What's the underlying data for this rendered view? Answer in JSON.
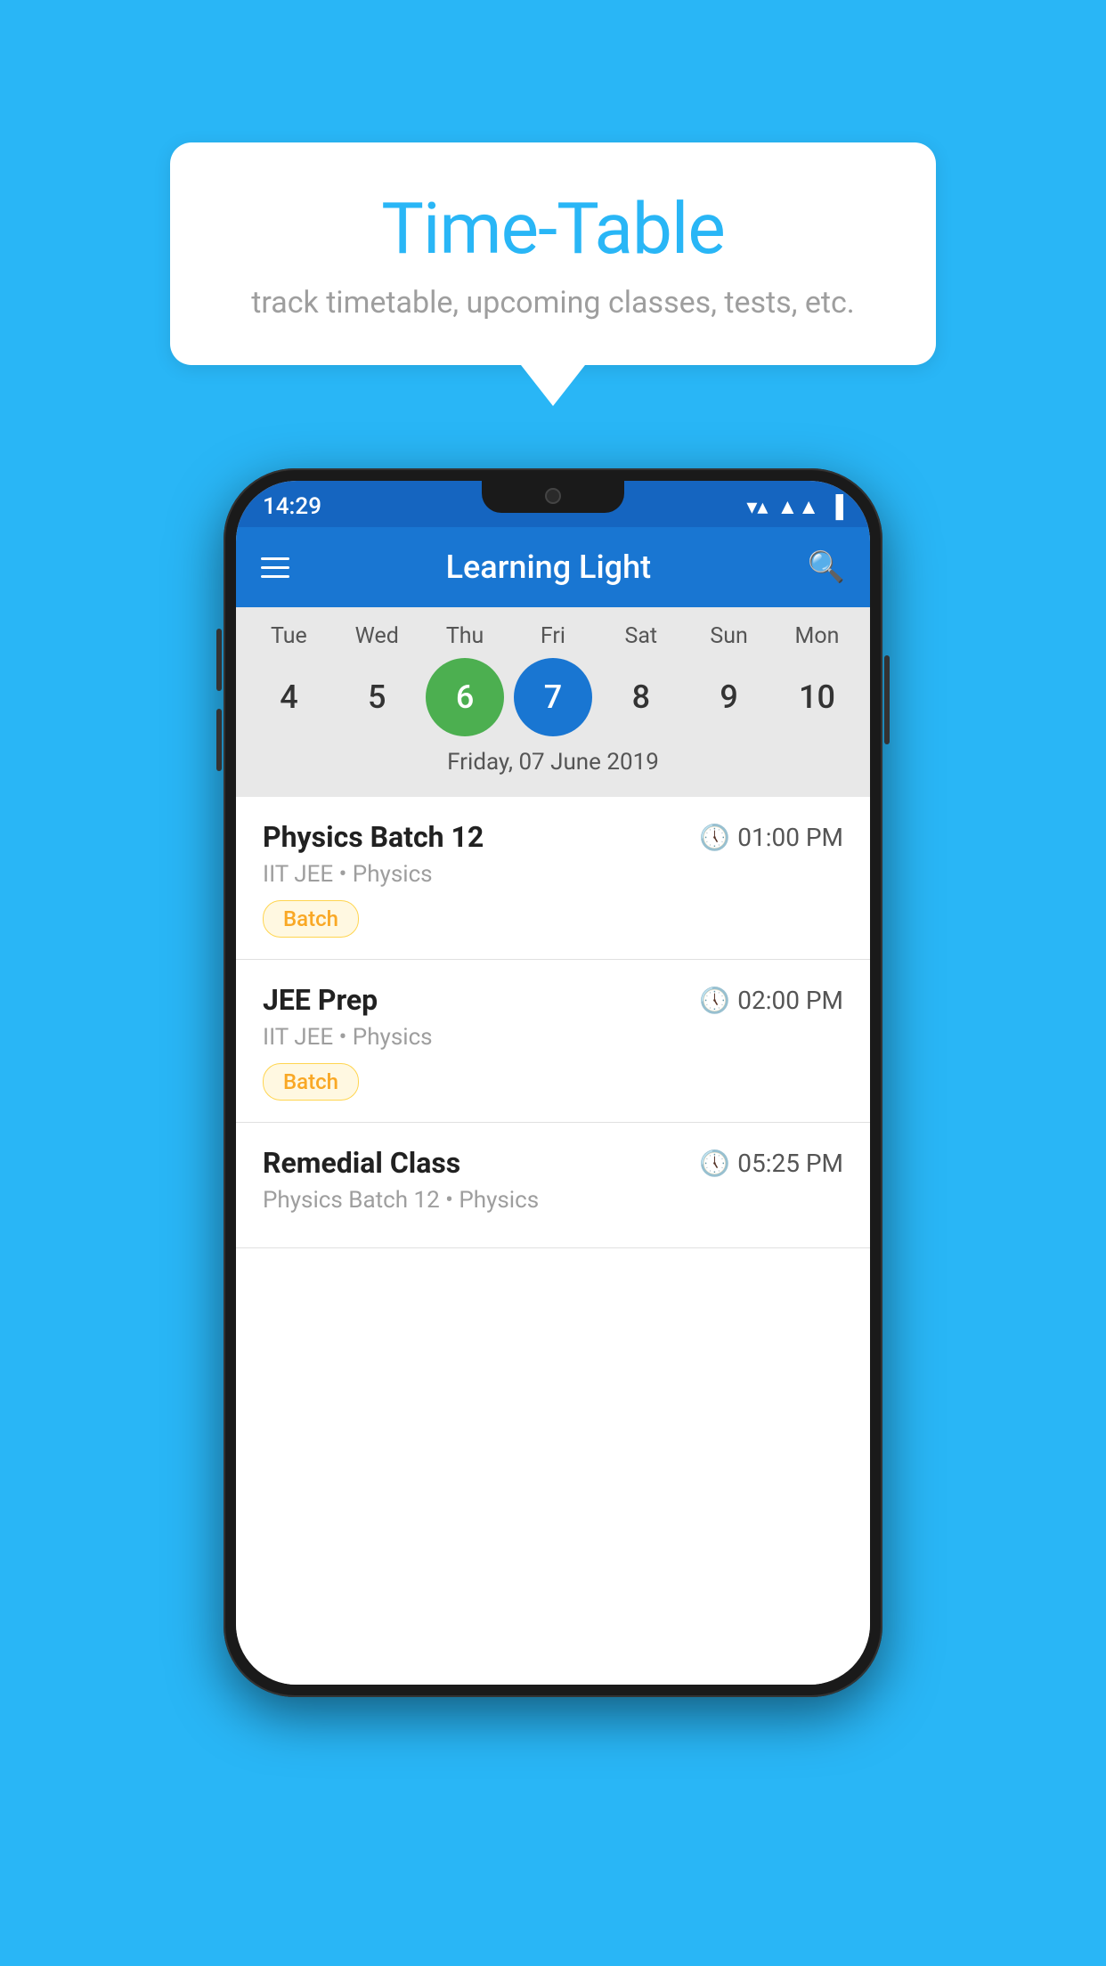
{
  "page": {
    "background_color": "#29B6F6"
  },
  "speech_bubble": {
    "title": "Time-Table",
    "subtitle": "track timetable, upcoming classes, tests, etc."
  },
  "status_bar": {
    "time": "14:29"
  },
  "app_bar": {
    "title": "Learning Light"
  },
  "calendar": {
    "selected_date_label": "Friday, 07 June 2019",
    "days": [
      {
        "name": "Tue",
        "number": "4",
        "state": "normal"
      },
      {
        "name": "Wed",
        "number": "5",
        "state": "normal"
      },
      {
        "name": "Thu",
        "number": "6",
        "state": "today"
      },
      {
        "name": "Fri",
        "number": "7",
        "state": "selected"
      },
      {
        "name": "Sat",
        "number": "8",
        "state": "normal"
      },
      {
        "name": "Sun",
        "number": "9",
        "state": "normal"
      },
      {
        "name": "Mon",
        "number": "10",
        "state": "normal"
      }
    ]
  },
  "schedule": [
    {
      "title": "Physics Batch 12",
      "time": "01:00 PM",
      "subtitle": "IIT JEE • Physics",
      "badge": "Batch"
    },
    {
      "title": "JEE Prep",
      "time": "02:00 PM",
      "subtitle": "IIT JEE • Physics",
      "badge": "Batch"
    },
    {
      "title": "Remedial Class",
      "time": "05:25 PM",
      "subtitle": "Physics Batch 12 • Physics",
      "badge": null
    }
  ]
}
